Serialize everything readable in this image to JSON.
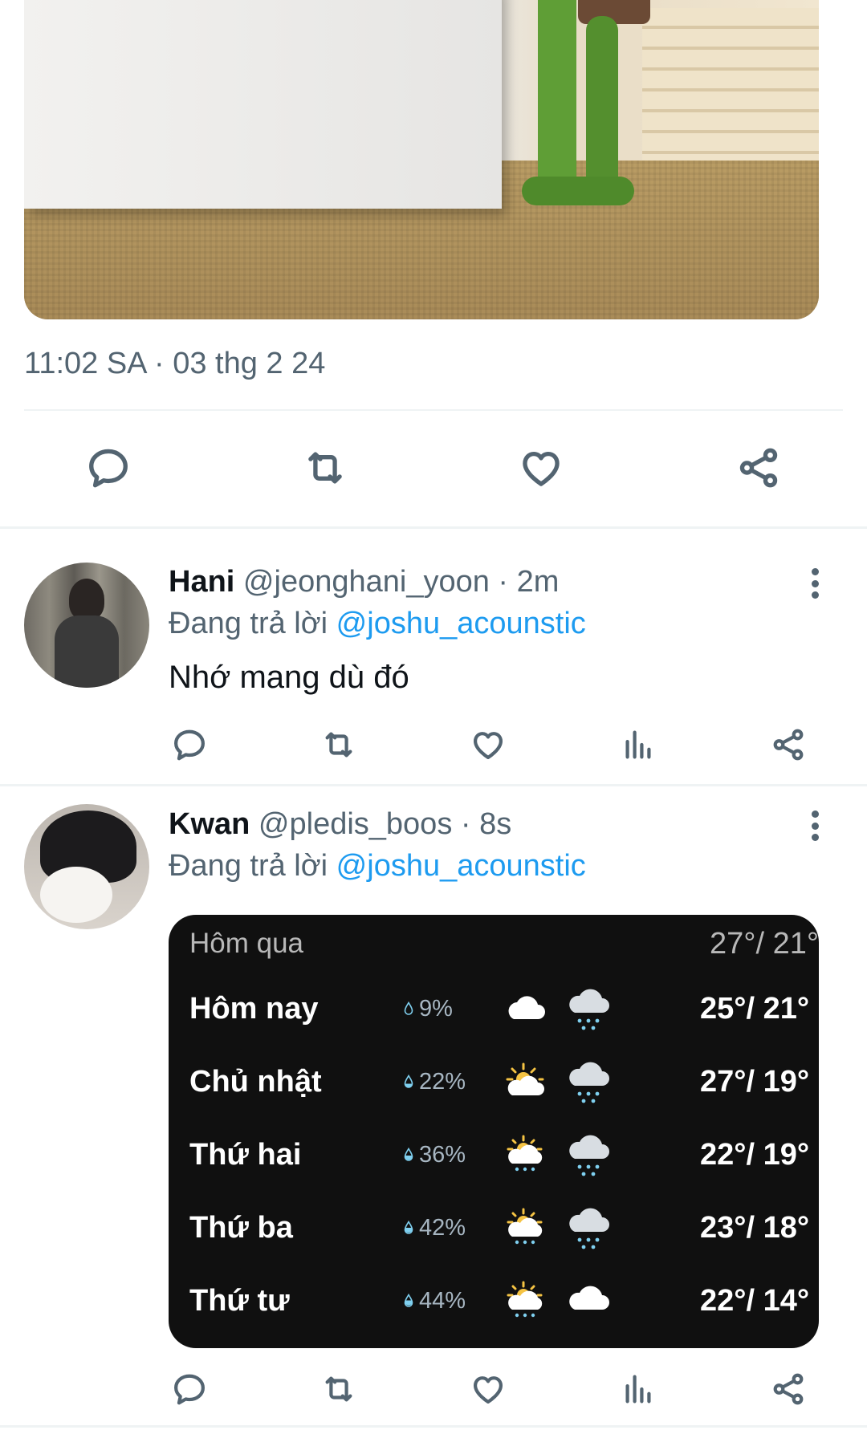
{
  "main_tweet": {
    "timestamp": "11:02 SA · 03 thg 2 24",
    "actions": [
      "reply-icon",
      "retweet-icon",
      "like-icon",
      "share-icon"
    ]
  },
  "replies": [
    {
      "name": "Hani",
      "meta": "@jeonghani_yoon · 2m",
      "replying_prefix": "Đang trả lời",
      "replying_handle": "@joshu_acounstic",
      "text": "Nhớ mang dù đó",
      "actions": [
        "reply-icon",
        "retweet-icon",
        "like-icon",
        "views-icon",
        "share-icon"
      ]
    },
    {
      "name": "Kwan",
      "meta": "@pledis_boos · 8s",
      "replying_prefix": "Đang trả lời",
      "replying_handle": "@joshu_acounstic",
      "actions": [
        "reply-icon",
        "retweet-icon",
        "like-icon",
        "views-icon",
        "share-icon"
      ]
    }
  ],
  "weather": {
    "yesterday": {
      "day": "Hôm qua",
      "temp": "27°/ 21°"
    },
    "days": [
      {
        "day": "Hôm nay",
        "rain": "9%",
        "icon_day": "cloud-icon",
        "icon_night": "cloud-rain-icon",
        "temp": "25°/ 21°"
      },
      {
        "day": "Chủ nhật",
        "rain": "22%",
        "icon_day": "partly-sunny-icon",
        "icon_night": "cloud-rain-icon",
        "temp": "27°/ 19°"
      },
      {
        "day": "Thứ hai",
        "rain": "36%",
        "icon_day": "sun-cloud-rain-icon",
        "icon_night": "cloud-rain-icon",
        "temp": "22°/ 19°"
      },
      {
        "day": "Thứ ba",
        "rain": "42%",
        "icon_day": "sun-cloud-rain-icon",
        "icon_night": "cloud-rain-icon",
        "temp": "23°/ 18°"
      },
      {
        "day": "Thứ tư",
        "rain": "44%",
        "icon_day": "sun-cloud-rain-icon",
        "icon_night": "cloud-icon",
        "temp": "22°/ 14°"
      }
    ]
  },
  "colors": {
    "text_primary": "#0f1419",
    "text_secondary": "#536471",
    "link": "#1d9bf0",
    "divider": "#eff3f4",
    "weather_bg": "#101010"
  }
}
